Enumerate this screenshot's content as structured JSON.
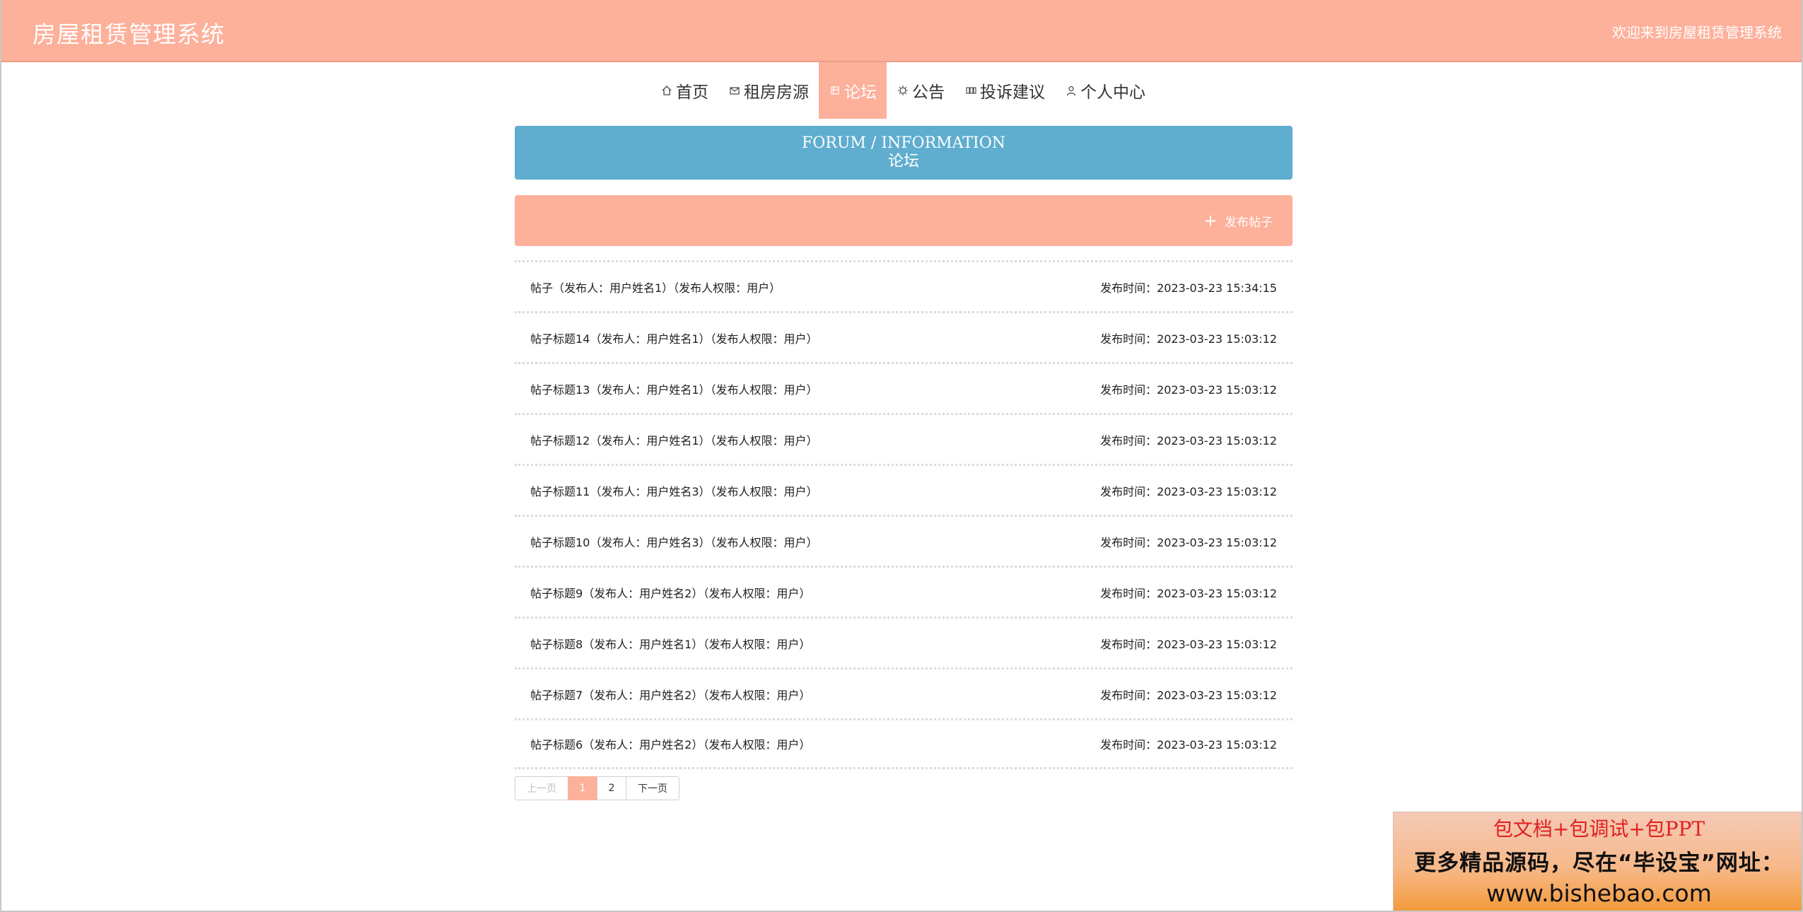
{
  "header": {
    "title": "房屋租赁管理系统",
    "welcome": "欢迎来到房屋租赁管理系统"
  },
  "nav": {
    "items": [
      {
        "label": "首页",
        "icon": "home-icon"
      },
      {
        "label": "租房房源",
        "icon": "mail-icon"
      },
      {
        "label": "论坛",
        "icon": "forum-icon",
        "active": true
      },
      {
        "label": "公告",
        "icon": "notice-icon"
      },
      {
        "label": "投诉建议",
        "icon": "feedback-icon"
      },
      {
        "label": "个人中心",
        "icon": "user-icon"
      }
    ]
  },
  "banner": {
    "en": "FORUM / INFORMATION",
    "zh": "论坛"
  },
  "actions": {
    "publish_icon": "+",
    "publish_label": "发布帖子"
  },
  "posts": [
    {
      "title": "帖子（发布人：用户姓名1）（发布人权限：用户）",
      "time": "发布时间：2023-03-23 15:34:15"
    },
    {
      "title": "帖子标题14（发布人：用户姓名1）（发布人权限：用户）",
      "time": "发布时间：2023-03-23 15:03:12"
    },
    {
      "title": "帖子标题13（发布人：用户姓名1）（发布人权限：用户）",
      "time": "发布时间：2023-03-23 15:03:12"
    },
    {
      "title": "帖子标题12（发布人：用户姓名1）（发布人权限：用户）",
      "time": "发布时间：2023-03-23 15:03:12"
    },
    {
      "title": "帖子标题11（发布人：用户姓名3）（发布人权限：用户）",
      "time": "发布时间：2023-03-23 15:03:12"
    },
    {
      "title": "帖子标题10（发布人：用户姓名3）（发布人权限：用户）",
      "time": "发布时间：2023-03-23 15:03:12"
    },
    {
      "title": "帖子标题9（发布人：用户姓名2）（发布人权限：用户）",
      "time": "发布时间：2023-03-23 15:03:12"
    },
    {
      "title": "帖子标题8（发布人：用户姓名1）（发布人权限：用户）",
      "time": "发布时间：2023-03-23 15:03:12"
    },
    {
      "title": "帖子标题7（发布人：用户姓名2）（发布人权限：用户）",
      "time": "发布时间：2023-03-23 15:03:12"
    },
    {
      "title": "帖子标题6（发布人：用户姓名2）（发布人权限：用户）",
      "time": "发布时间：2023-03-23 15:03:12"
    }
  ],
  "pagination": {
    "prev": "上一页",
    "pages": [
      "1",
      "2"
    ],
    "current": "1",
    "next": "下一页"
  },
  "ad": {
    "line1": "包文档+包调试+包PPT",
    "line2": "更多精品源码，尽在“毕设宝”网址：",
    "line3": "www.bishebao.com"
  },
  "colors": {
    "accent": "#fdb09a",
    "banner": "#5fadcf"
  }
}
